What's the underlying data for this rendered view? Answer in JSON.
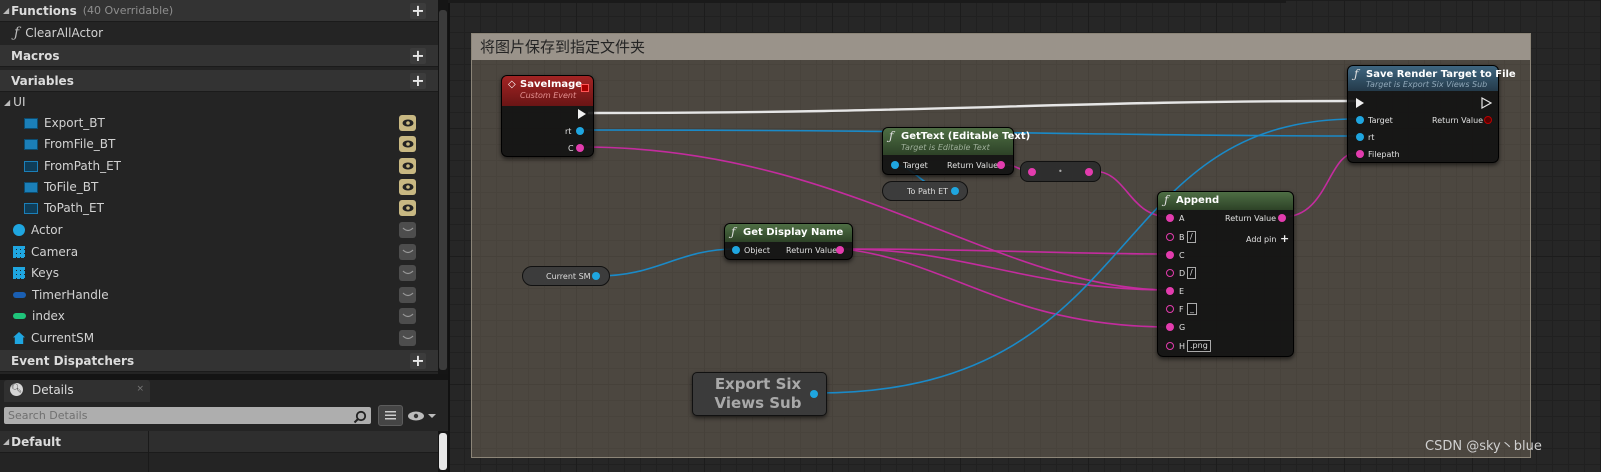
{
  "panel": {
    "functions_label": "Functions",
    "functions_overridable": "(40 Overridable)",
    "function_items": [
      "ClearAllActor"
    ],
    "macros_label": "Macros",
    "variables_label": "Variables",
    "ui_group": "UI",
    "ui_vars": [
      "Export_BT",
      "FromFile_BT",
      "FromPath_ET",
      "ToFile_BT",
      "ToPath_ET"
    ],
    "other_vars": [
      "Actor",
      "Camera",
      "Keys",
      "TimerHandle",
      "index",
      "CurrentSM"
    ],
    "event_dispatchers_label": "Event Dispatchers",
    "details_tab": "Details",
    "search_placeholder": "Search Details",
    "default_label": "Default"
  },
  "graph": {
    "comment_title": "将图片保存到指定文件夹",
    "save_image": {
      "title": "SaveImage",
      "subtitle": "Custom Event",
      "pin_rt": "rt",
      "pin_c": "C"
    },
    "get_text": {
      "title": "GetText (Editable Text)",
      "subtitle": "Target is Editable Text",
      "pin_target": "Target",
      "pin_return": "Return Value"
    },
    "to_path_et": "To Path ET",
    "get_display_name": {
      "title": "Get Display Name",
      "pin_object": "Object",
      "pin_return": "Return Value"
    },
    "current_sm": "Current SM",
    "append": {
      "title": "Append",
      "pin_a": "A",
      "pin_b": "B",
      "pin_c": "C",
      "pin_d": "D",
      "pin_e": "E",
      "pin_f": "F",
      "pin_g": "G",
      "pin_h": "H",
      "return": "Return Value",
      "add_pin": "Add pin",
      "b_value": "/",
      "d_value": "/",
      "f_value": "_",
      "h_value": ".png"
    },
    "save_rt": {
      "title": "Save Render Target to File",
      "subtitle": "Target is Export Six Views Sub",
      "pin_target": "Target",
      "pin_rt": "rt",
      "pin_filepath": "Filepath",
      "pin_return": "Return Value"
    },
    "export_six_views_sub": "Export Six Views Sub",
    "watermark": "CSDN @sky丶blue"
  },
  "colors": {
    "string_pin": "#e33cae",
    "object_pin": "#1fa6e0",
    "event_header": "#8a1c1c",
    "function_header": "#3b5a6e",
    "pure_header": "#3f5b34"
  }
}
